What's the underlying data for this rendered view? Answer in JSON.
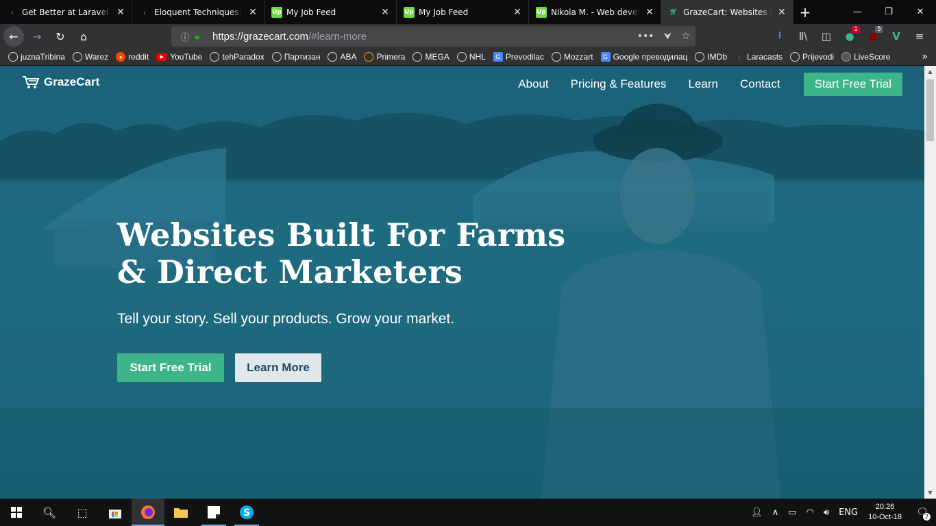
{
  "browser": {
    "tabs": [
      {
        "title": "Get Better at Laravel with",
        "icon": "laracasts-icon",
        "active": false
      },
      {
        "title": "Eloquent Techniques: Re",
        "icon": "laracasts-icon",
        "active": false
      },
      {
        "title": "My Job Feed",
        "icon": "upwork-icon",
        "active": false
      },
      {
        "title": "My Job Feed",
        "icon": "upwork-icon",
        "active": false
      },
      {
        "title": "Nikola M. - Web develop",
        "icon": "upwork-icon",
        "active": false
      },
      {
        "title": "GrazeCart: Websites Built",
        "icon": "grazecart-icon",
        "active": true
      }
    ],
    "upwork_favicon": "Up",
    "url_host": "https://grazecart.com",
    "url_path": "/#learn-more",
    "toolbar_badges": {
      "ublock": "1",
      "ublock2": "5"
    },
    "bookmarks": [
      {
        "label": "juznaTribina",
        "icon": "globe-icon"
      },
      {
        "label": "Warez",
        "icon": "globe-icon"
      },
      {
        "label": "reddit",
        "icon": "reddit-icon"
      },
      {
        "label": "YouTube",
        "icon": "youtube-icon"
      },
      {
        "label": "tehParadox",
        "icon": "globe-icon"
      },
      {
        "label": "Партизан",
        "icon": "globe-icon"
      },
      {
        "label": "ABA",
        "icon": "globe-icon"
      },
      {
        "label": "Primera",
        "icon": "primera-icon"
      },
      {
        "label": "MEGA",
        "icon": "globe-icon"
      },
      {
        "label": "NHL",
        "icon": "globe-icon"
      },
      {
        "label": "Prevodilac",
        "icon": "google-translate-icon"
      },
      {
        "label": "Mozzart",
        "icon": "globe-icon"
      },
      {
        "label": "Google преводилац",
        "icon": "google-translate-icon"
      },
      {
        "label": "IMDb",
        "icon": "globe-icon"
      },
      {
        "label": "Laracasts",
        "icon": "laracasts-icon"
      },
      {
        "label": "Prijevodi",
        "icon": "globe-icon"
      },
      {
        "label": "LiveScore",
        "icon": "livescore-icon"
      }
    ]
  },
  "site": {
    "logo_text": "GrazeCart",
    "nav": {
      "about": "About",
      "pricing": "Pricing & Features",
      "learn": "Learn",
      "contact": "Contact",
      "cta": "Start Free Trial"
    },
    "hero": {
      "title_line1": "Websites Built For Farms",
      "title_line2": "& Direct Marketers",
      "subtitle": "Tell your story. Sell your products. Grow your market.",
      "primary_button": "Start Free Trial",
      "secondary_button": "Learn More"
    },
    "colors": {
      "accent": "#3eb489",
      "overlay": "#1e6a80"
    }
  },
  "taskbar": {
    "lang": "ENG",
    "time": "20:26",
    "date": "10-Oct-18",
    "notification_count": "2"
  }
}
